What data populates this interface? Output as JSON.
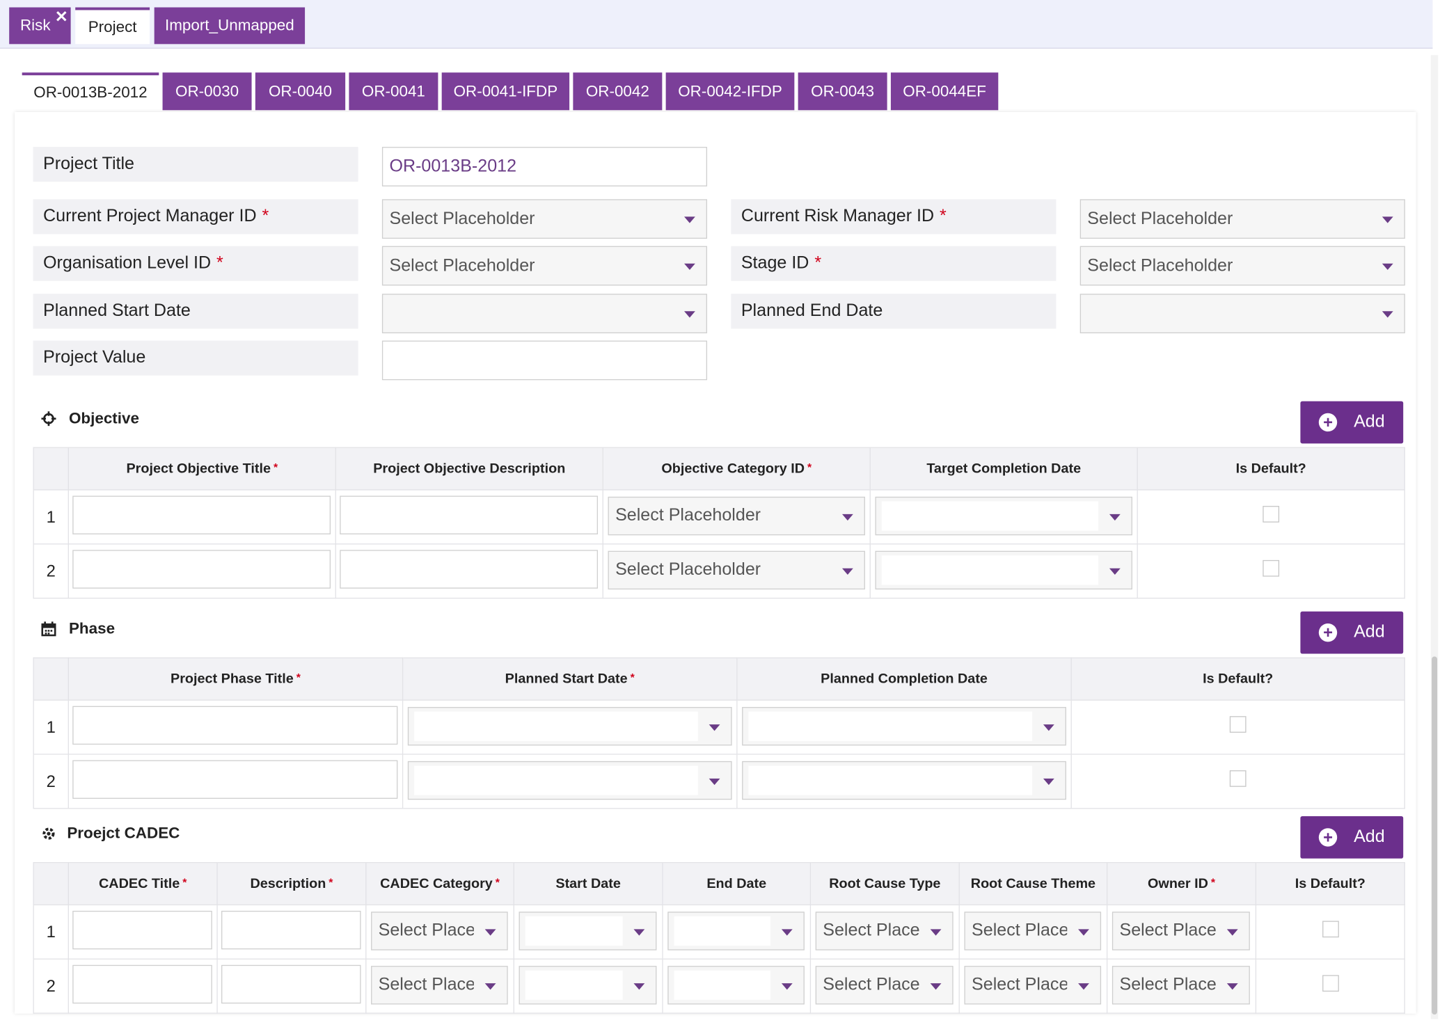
{
  "top_tabs": [
    {
      "label": "Risk",
      "close": "✕"
    },
    {
      "label": "Project"
    },
    {
      "label": "Import_Unmapped"
    }
  ],
  "project_tabs": [
    "OR-0013B-2012",
    "OR-0030",
    "OR-0040",
    "OR-0041",
    "OR-0041-IFDP",
    "OR-0042",
    "OR-0042-IFDP",
    "OR-0043",
    "OR-0044EF"
  ],
  "form": {
    "project_title_label": "Project Title",
    "project_title_value": "OR-0013B-2012",
    "pm_label": "Current Project Manager ID",
    "rm_label": "Current Risk Manager ID",
    "org_label": "Organisation Level ID",
    "stage_label": "Stage ID",
    "start_label": "Planned Start Date",
    "end_label": "Planned End Date",
    "value_label": "Project Value",
    "placeholder": "Select Placeholder",
    "required_mark": "*"
  },
  "objective": {
    "title": "Objective",
    "add_label": "Add",
    "headers": [
      "Project Objective Title",
      "Project Objective Description",
      "Objective Category ID",
      "Target Completion Date",
      "Is Default?"
    ],
    "rows": [
      "1",
      "2"
    ],
    "select_placeholder": "Select Placeholder"
  },
  "phase": {
    "title": "Phase",
    "add_label": "Add",
    "headers": [
      "Project Phase Title",
      "Planned Start Date",
      "Planned Completion Date",
      "Is Default?"
    ],
    "rows": [
      "1",
      "2"
    ]
  },
  "cadec": {
    "title": "Proejct CADEC",
    "add_label": "Add",
    "headers": [
      "CADEC Title",
      "Description",
      "CADEC Category",
      "Start Date",
      "End Date",
      "Root Cause Type",
      "Root Cause Theme",
      "Owner ID",
      "Is Default?"
    ],
    "rows": [
      "1",
      "2"
    ],
    "select_short": "Select Placel"
  },
  "colors": {
    "accent": "#7b3f99",
    "button": "#6b2f8c",
    "required": "#d0021b"
  }
}
